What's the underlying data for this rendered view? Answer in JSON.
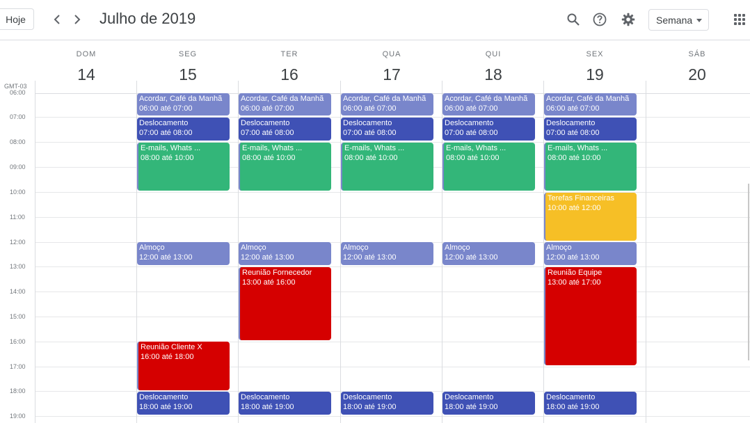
{
  "header": {
    "today_label": "Hoje",
    "title": "Julho de 2019",
    "view_label": "Semana",
    "icons": [
      "chevron-left-icon",
      "chevron-right-icon",
      "search-icon",
      "help-icon",
      "gear-icon",
      "apps-grid-icon"
    ]
  },
  "timezone": "GMT-03",
  "days": [
    {
      "dow": "DOM",
      "num": "14"
    },
    {
      "dow": "SEG",
      "num": "15"
    },
    {
      "dow": "TER",
      "num": "16"
    },
    {
      "dow": "QUA",
      "num": "17"
    },
    {
      "dow": "QUI",
      "num": "18"
    },
    {
      "dow": "SEX",
      "num": "19"
    },
    {
      "dow": "SÁB",
      "num": "20"
    }
  ],
  "hours": [
    "06:00",
    "07:00",
    "08:00",
    "09:00",
    "10:00",
    "11:00",
    "12:00",
    "13:00",
    "14:00",
    "15:00",
    "16:00",
    "17:00",
    "18:00",
    "19:00"
  ],
  "events": {
    "seg": [
      {
        "title": "Acordar, Café da Manhã",
        "time": "06:00 até 07:00"
      },
      {
        "title": "Deslocamento",
        "time": "07:00 até 08:00"
      },
      {
        "title": "E-mails, Whats ...",
        "time": "08:00 até 10:00"
      },
      {
        "title": "Almoço",
        "time": "12:00 até 13:00"
      },
      {
        "title": "Reunião Cliente X",
        "time": "16:00 até 18:00"
      },
      {
        "title": "Deslocamento",
        "time": "18:00 até 19:00"
      }
    ],
    "ter": [
      {
        "title": "Acordar, Café da Manhã",
        "time": "06:00 até 07:00"
      },
      {
        "title": "Deslocamento",
        "time": "07:00 até 08:00"
      },
      {
        "title": "E-mails, Whats ...",
        "time": "08:00 até 10:00"
      },
      {
        "title": "Almoço",
        "time": "12:00 até 13:00"
      },
      {
        "title": "Reunião Fornecedor",
        "time": "13:00 até 16:00"
      },
      {
        "title": "Deslocamento",
        "time": "18:00 até 19:00"
      }
    ],
    "qua": [
      {
        "title": "Acordar, Café da Manhã",
        "time": "06:00 até 07:00"
      },
      {
        "title": "Deslocamento",
        "time": "07:00 até 08:00"
      },
      {
        "title": "E-mails, Whats ...",
        "time": "08:00 até 10:00"
      },
      {
        "title": "Almoço",
        "time": "12:00 até 13:00"
      },
      {
        "title": "Deslocamento",
        "time": "18:00 até 19:00"
      }
    ],
    "qui": [
      {
        "title": "Acordar, Café da Manhã",
        "time": "06:00 até 07:00"
      },
      {
        "title": "Deslocamento",
        "time": "07:00 até 08:00"
      },
      {
        "title": "E-mails, Whats ...",
        "time": "08:00 até 10:00"
      },
      {
        "title": "Almoço",
        "time": "12:00 até 13:00"
      },
      {
        "title": "Deslocamento",
        "time": "18:00 até 19:00"
      }
    ],
    "sex": [
      {
        "title": "Acordar, Café da Manhã",
        "time": "06:00 até 07:00"
      },
      {
        "title": "Deslocamento",
        "time": "07:00 até 08:00"
      },
      {
        "title": "E-mails, Whats ...",
        "time": "08:00 até 10:00"
      },
      {
        "title": "Terefas Financeiras",
        "time": "10:00 até 12:00"
      },
      {
        "title": "Almoço",
        "time": "12:00 até 13:00"
      },
      {
        "title": "Reunião Equipe",
        "time": "13:00 até 17:00"
      },
      {
        "title": "Deslocamento",
        "time": "18:00 até 19:00"
      }
    ]
  },
  "colors": {
    "blue": "#3f51b5",
    "lavender": "#7986cb",
    "green": "#33b679",
    "red": "#d50000",
    "yellow": "#f6bf26"
  }
}
